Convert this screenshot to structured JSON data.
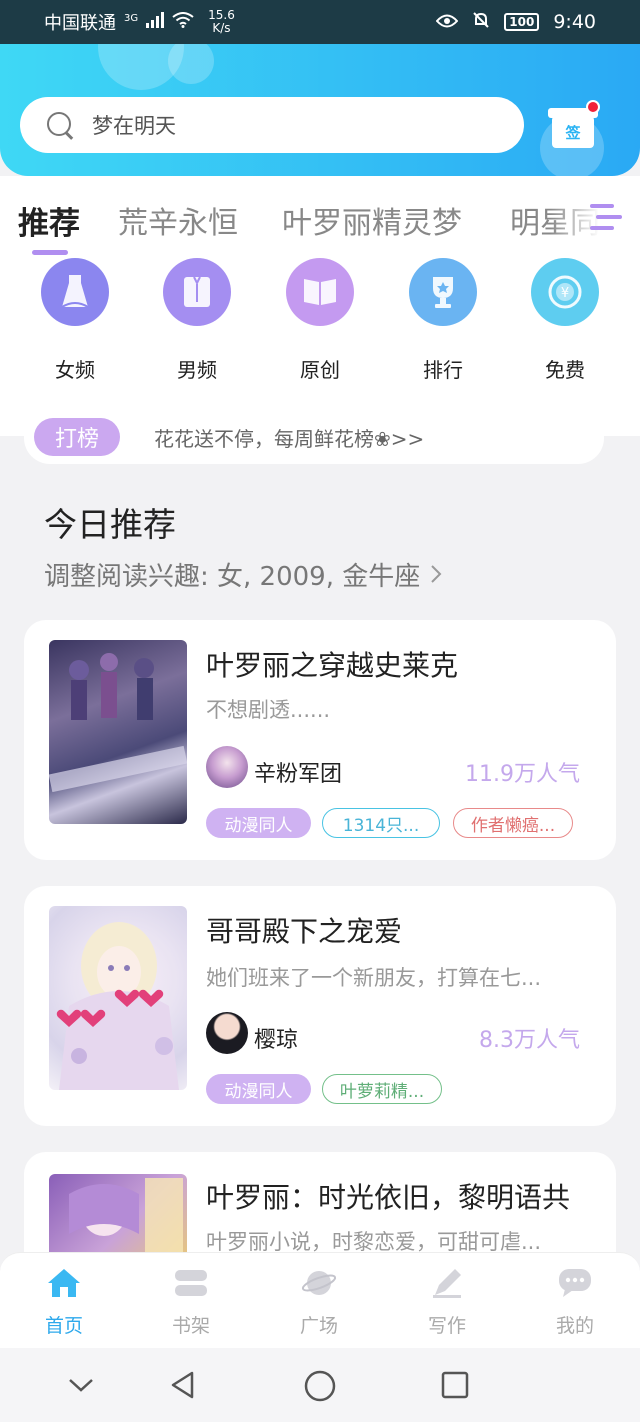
{
  "status_bar": {
    "carrier": "中国联通",
    "network": "3G",
    "speed_value": "15.6",
    "speed_unit": "K/s",
    "battery": "100",
    "time": "9:40"
  },
  "search": {
    "placeholder": "梦在明天"
  },
  "sign_in": {
    "label": "签"
  },
  "tabs": [
    {
      "label": "推荐",
      "active": true
    },
    {
      "label": "荒辛永恒"
    },
    {
      "label": "叶罗丽精灵梦"
    },
    {
      "label": "明星同"
    }
  ],
  "categories": [
    {
      "label": "女频",
      "icon": "dress-icon",
      "color": "#8b86ef"
    },
    {
      "label": "男频",
      "icon": "shirt-icon",
      "color": "#a48ef1"
    },
    {
      "label": "原创",
      "icon": "book-icon",
      "color": "#c49af0"
    },
    {
      "label": "排行",
      "icon": "trophy-icon",
      "color": "#6ab4f2"
    },
    {
      "label": "免费",
      "icon": "yuan-coin-icon",
      "color": "#5ecdf0"
    }
  ],
  "promo": {
    "tag": "打榜",
    "text": "花花送不停，每周鲜花榜❀>>"
  },
  "section": {
    "title": "今日推荐",
    "subtitle": "调整阅读兴趣: 女, 2009, 金牛座"
  },
  "books": [
    {
      "title": "叶罗丽之穿越史莱克",
      "desc": "不想剧透......",
      "author": "辛粉军团",
      "popularity": "11.9万人气",
      "tags": [
        "动漫同人",
        "1314只...",
        "作者懒癌..."
      ]
    },
    {
      "title": "哥哥殿下之宠爱",
      "desc": "她们班来了一个新朋友，打算在七...",
      "author": "樱琼",
      "popularity": "8.3万人气",
      "tags": [
        "动漫同人",
        "叶萝莉精..."
      ]
    },
    {
      "title": "叶罗丽：时光依旧，黎明语共",
      "desc": "叶罗丽小说，时黎恋爱，可甜可虐..."
    }
  ],
  "bottom_nav": [
    {
      "label": "首页",
      "icon": "home-icon",
      "active": true
    },
    {
      "label": "书架",
      "icon": "bookshelf-icon"
    },
    {
      "label": "广场",
      "icon": "planet-icon"
    },
    {
      "label": "写作",
      "icon": "pen-icon"
    },
    {
      "label": "我的",
      "icon": "chat-icon"
    }
  ],
  "colors": {
    "accent": "#2ea9ec",
    "purple": "#b08ef0",
    "header_gradient_start": "#3fd8f5",
    "header_gradient_end": "#2aa9f4"
  }
}
